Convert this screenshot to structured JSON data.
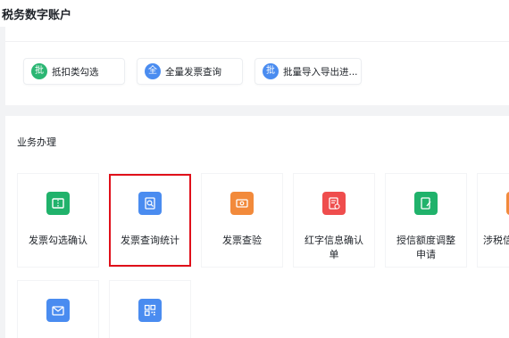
{
  "page": {
    "title": "税务数字账户"
  },
  "quick_actions": [
    {
      "icon_char": "批",
      "icon_name": "batch-check-icon",
      "label": "抵扣类勾选",
      "color": "#2bb673"
    },
    {
      "icon_char": "全",
      "icon_name": "all-invoices-icon",
      "label": "全量发票查询",
      "color": "#4a8cf0"
    },
    {
      "icon_char": "批",
      "icon_name": "batch-import-icon",
      "label": "批量导入导出进...",
      "color": "#4a8cf0"
    }
  ],
  "business": {
    "section_title": "业务办理",
    "cards": [
      {
        "icon_name": "ticket-check-icon",
        "label": "发票勾选确认",
        "color": "#20b26b"
      },
      {
        "icon_name": "invoice-search-icon",
        "label": "发票查询统计",
        "color": "#4a8cf0",
        "highlighted": true
      },
      {
        "icon_name": "invoice-verify-icon",
        "label": "发票查验",
        "color": "#f28a3b"
      },
      {
        "icon_name": "red-letter-icon",
        "label": "红字信息确认单",
        "color": "#ef4d4d"
      },
      {
        "icon_name": "credit-adjust-icon",
        "label": "授信额度调整申请",
        "color": "#20b26b"
      },
      {
        "icon_name": "tax-related-icon",
        "label": "涉税信",
        "color": "#f28a3b"
      },
      {
        "icon_name": "mail-icon",
        "label": "",
        "color": "#4a8cf0"
      },
      {
        "icon_name": "qr-code-icon",
        "label": "",
        "color": "#4a8cf0"
      }
    ]
  }
}
